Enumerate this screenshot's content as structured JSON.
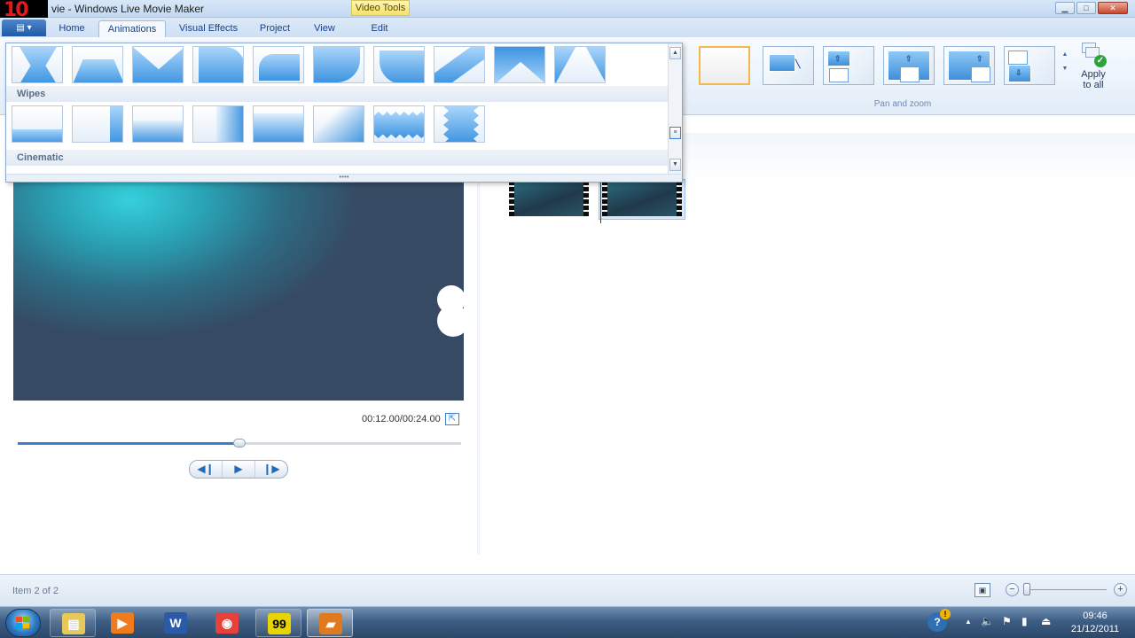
{
  "titlebar": {
    "logo": "10",
    "title": "vie - Windows Live Movie Maker",
    "context_group": "Video Tools",
    "controls": {
      "minimize": "▁",
      "maximize": "□",
      "close": "✕"
    }
  },
  "ribbon_tabs": {
    "app_menu": "▤ ▾",
    "items": [
      {
        "label": "Home"
      },
      {
        "label": "Animations"
      },
      {
        "label": "Visual Effects"
      },
      {
        "label": "Project"
      },
      {
        "label": "View"
      },
      {
        "label": "Edit"
      }
    ],
    "active": "Animations"
  },
  "gallery": {
    "sections": {
      "wipes": "Wipes",
      "cinematic": "Cinematic"
    },
    "top_row_icon": "transition-thumbnail",
    "scroll_up": "▲",
    "scroll_down": "▼",
    "scroll_more": "≡",
    "resize_grip": "••••"
  },
  "pan_zoom": {
    "group_label": "Pan and zoom",
    "scroll_up": "▲",
    "scroll_more": "▼",
    "apply_all_line1": "Apply",
    "apply_all_line2": "to all",
    "apply_all_check": "✓"
  },
  "preview": {
    "time": "00:12.00/00:24.00",
    "progress": 0.5,
    "fullscreen_icon": "⇱",
    "controls": {
      "previous": "◀❙",
      "play": "▶",
      "next": "❙▶"
    }
  },
  "storyboard": {
    "clips": 2,
    "selected_index": 1
  },
  "status": {
    "text": "Item 2 of 2",
    "thumbnail_icon": "▣",
    "zoom_minus": "−",
    "zoom_plus": "+"
  },
  "taskbar": {
    "apps": [
      {
        "name": "explorer",
        "glyph": "▤",
        "color": "#e9c85a"
      },
      {
        "name": "media-player",
        "glyph": "▶",
        "color": "#f07b1c"
      },
      {
        "name": "word",
        "glyph": "W",
        "color": "#2a5aa8"
      },
      {
        "name": "chrome",
        "glyph": "◉",
        "color": "#e4423a"
      },
      {
        "name": "fraps",
        "glyph": "99",
        "color": "#e8d400"
      },
      {
        "name": "movie-maker",
        "glyph": "▰",
        "color": "#e07a1f"
      }
    ],
    "tray": {
      "help": "?",
      "up_arrow": "▲",
      "volume": "🔈",
      "flag": "⚑",
      "network": "▮",
      "usb": "⏏"
    },
    "clock_time": "09:46",
    "clock_date": "21/12/2011"
  },
  "colors": {
    "accent": "#3e7dc9",
    "selection": "#f2b84b",
    "preview_cyan": "#36cfdb",
    "preview_dark": "#364a63"
  }
}
